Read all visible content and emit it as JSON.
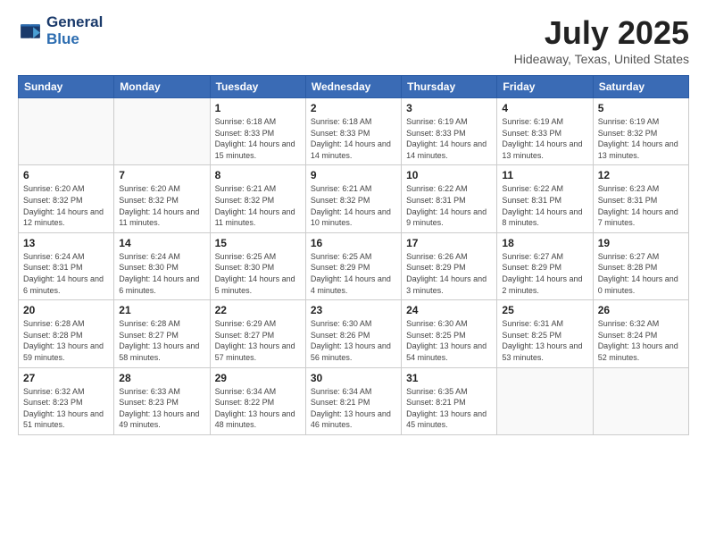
{
  "header": {
    "logo_line1": "General",
    "logo_line2": "Blue",
    "title": "July 2025",
    "subtitle": "Hideaway, Texas, United States"
  },
  "weekdays": [
    "Sunday",
    "Monday",
    "Tuesday",
    "Wednesday",
    "Thursday",
    "Friday",
    "Saturday"
  ],
  "weeks": [
    [
      {
        "day": "",
        "info": ""
      },
      {
        "day": "",
        "info": ""
      },
      {
        "day": "1",
        "info": "Sunrise: 6:18 AM\nSunset: 8:33 PM\nDaylight: 14 hours and 15 minutes."
      },
      {
        "day": "2",
        "info": "Sunrise: 6:18 AM\nSunset: 8:33 PM\nDaylight: 14 hours and 14 minutes."
      },
      {
        "day": "3",
        "info": "Sunrise: 6:19 AM\nSunset: 8:33 PM\nDaylight: 14 hours and 14 minutes."
      },
      {
        "day": "4",
        "info": "Sunrise: 6:19 AM\nSunset: 8:33 PM\nDaylight: 14 hours and 13 minutes."
      },
      {
        "day": "5",
        "info": "Sunrise: 6:19 AM\nSunset: 8:32 PM\nDaylight: 14 hours and 13 minutes."
      }
    ],
    [
      {
        "day": "6",
        "info": "Sunrise: 6:20 AM\nSunset: 8:32 PM\nDaylight: 14 hours and 12 minutes."
      },
      {
        "day": "7",
        "info": "Sunrise: 6:20 AM\nSunset: 8:32 PM\nDaylight: 14 hours and 11 minutes."
      },
      {
        "day": "8",
        "info": "Sunrise: 6:21 AM\nSunset: 8:32 PM\nDaylight: 14 hours and 11 minutes."
      },
      {
        "day": "9",
        "info": "Sunrise: 6:21 AM\nSunset: 8:32 PM\nDaylight: 14 hours and 10 minutes."
      },
      {
        "day": "10",
        "info": "Sunrise: 6:22 AM\nSunset: 8:31 PM\nDaylight: 14 hours and 9 minutes."
      },
      {
        "day": "11",
        "info": "Sunrise: 6:22 AM\nSunset: 8:31 PM\nDaylight: 14 hours and 8 minutes."
      },
      {
        "day": "12",
        "info": "Sunrise: 6:23 AM\nSunset: 8:31 PM\nDaylight: 14 hours and 7 minutes."
      }
    ],
    [
      {
        "day": "13",
        "info": "Sunrise: 6:24 AM\nSunset: 8:31 PM\nDaylight: 14 hours and 6 minutes."
      },
      {
        "day": "14",
        "info": "Sunrise: 6:24 AM\nSunset: 8:30 PM\nDaylight: 14 hours and 6 minutes."
      },
      {
        "day": "15",
        "info": "Sunrise: 6:25 AM\nSunset: 8:30 PM\nDaylight: 14 hours and 5 minutes."
      },
      {
        "day": "16",
        "info": "Sunrise: 6:25 AM\nSunset: 8:29 PM\nDaylight: 14 hours and 4 minutes."
      },
      {
        "day": "17",
        "info": "Sunrise: 6:26 AM\nSunset: 8:29 PM\nDaylight: 14 hours and 3 minutes."
      },
      {
        "day": "18",
        "info": "Sunrise: 6:27 AM\nSunset: 8:29 PM\nDaylight: 14 hours and 2 minutes."
      },
      {
        "day": "19",
        "info": "Sunrise: 6:27 AM\nSunset: 8:28 PM\nDaylight: 14 hours and 0 minutes."
      }
    ],
    [
      {
        "day": "20",
        "info": "Sunrise: 6:28 AM\nSunset: 8:28 PM\nDaylight: 13 hours and 59 minutes."
      },
      {
        "day": "21",
        "info": "Sunrise: 6:28 AM\nSunset: 8:27 PM\nDaylight: 13 hours and 58 minutes."
      },
      {
        "day": "22",
        "info": "Sunrise: 6:29 AM\nSunset: 8:27 PM\nDaylight: 13 hours and 57 minutes."
      },
      {
        "day": "23",
        "info": "Sunrise: 6:30 AM\nSunset: 8:26 PM\nDaylight: 13 hours and 56 minutes."
      },
      {
        "day": "24",
        "info": "Sunrise: 6:30 AM\nSunset: 8:25 PM\nDaylight: 13 hours and 54 minutes."
      },
      {
        "day": "25",
        "info": "Sunrise: 6:31 AM\nSunset: 8:25 PM\nDaylight: 13 hours and 53 minutes."
      },
      {
        "day": "26",
        "info": "Sunrise: 6:32 AM\nSunset: 8:24 PM\nDaylight: 13 hours and 52 minutes."
      }
    ],
    [
      {
        "day": "27",
        "info": "Sunrise: 6:32 AM\nSunset: 8:23 PM\nDaylight: 13 hours and 51 minutes."
      },
      {
        "day": "28",
        "info": "Sunrise: 6:33 AM\nSunset: 8:23 PM\nDaylight: 13 hours and 49 minutes."
      },
      {
        "day": "29",
        "info": "Sunrise: 6:34 AM\nSunset: 8:22 PM\nDaylight: 13 hours and 48 minutes."
      },
      {
        "day": "30",
        "info": "Sunrise: 6:34 AM\nSunset: 8:21 PM\nDaylight: 13 hours and 46 minutes."
      },
      {
        "day": "31",
        "info": "Sunrise: 6:35 AM\nSunset: 8:21 PM\nDaylight: 13 hours and 45 minutes."
      },
      {
        "day": "",
        "info": ""
      },
      {
        "day": "",
        "info": ""
      }
    ]
  ]
}
